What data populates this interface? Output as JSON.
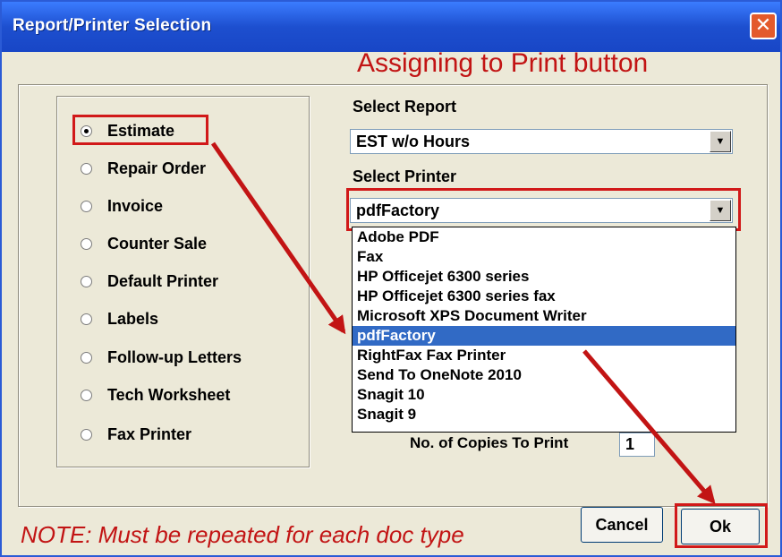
{
  "window": {
    "title": "Report/Printer Selection",
    "close_glyph": "✕"
  },
  "annotations": {
    "top": "Assigning to Print button",
    "bottom": "NOTE: Must be repeated for each doc type",
    "color": "#c21414"
  },
  "report_types": [
    {
      "label": "Estimate",
      "selected": true
    },
    {
      "label": "Repair Order",
      "selected": false
    },
    {
      "label": "Invoice",
      "selected": false
    },
    {
      "label": "Counter Sale",
      "selected": false
    },
    {
      "label": "Default Printer",
      "selected": false
    },
    {
      "label": "Labels",
      "selected": false
    },
    {
      "label": "Follow-up Letters",
      "selected": false
    },
    {
      "label": "Tech Worksheet",
      "selected": false
    },
    {
      "label": "Fax Printer",
      "selected": false
    }
  ],
  "select_report": {
    "label": "Select Report",
    "value": "EST w/o Hours"
  },
  "select_printer": {
    "label": "Select Printer",
    "value": "pdfFactory",
    "options": [
      "Adobe PDF",
      "Fax",
      "HP Officejet 6300 series",
      "HP Officejet 6300 series fax",
      "Microsoft XPS Document Writer",
      "pdfFactory",
      "RightFax Fax Printer",
      "Send To OneNote 2010",
      "Snagit 10",
      "Snagit 9"
    ],
    "highlighted": "pdfFactory"
  },
  "copies": {
    "label": "No. of Copies To Print",
    "value": "1"
  },
  "buttons": {
    "cancel": "Cancel",
    "ok": "Ok"
  },
  "icons": {
    "dropdown_arrow": "▼"
  }
}
